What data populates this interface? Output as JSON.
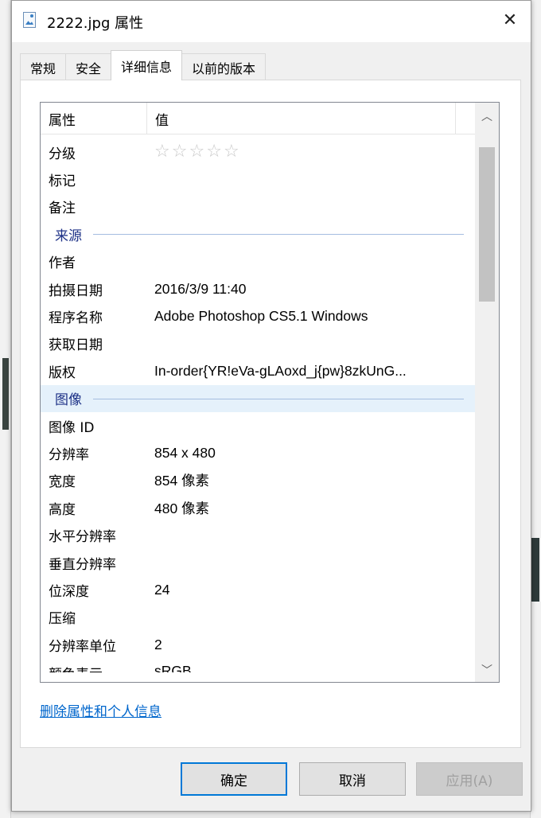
{
  "window": {
    "title": "2222.jpg 属性",
    "icon": "image-file-icon",
    "close_glyph": "✕"
  },
  "tabs": [
    {
      "label": "常规",
      "active": false
    },
    {
      "label": "安全",
      "active": false
    },
    {
      "label": "详细信息",
      "active": true
    },
    {
      "label": "以前的版本",
      "active": false
    }
  ],
  "columns": {
    "property": "属性",
    "value": "值"
  },
  "rating": {
    "stars": 0,
    "max": 5,
    "glyph": "☆"
  },
  "rows": [
    {
      "key": "分级",
      "type": "rating"
    },
    {
      "key": "标记",
      "value": ""
    },
    {
      "key": "备注",
      "value": ""
    },
    {
      "group": "来源"
    },
    {
      "key": "作者",
      "value": ""
    },
    {
      "key": "拍摄日期",
      "value": "2016/3/9 11:40"
    },
    {
      "key": "程序名称",
      "value": "Adobe Photoshop CS5.1 Windows"
    },
    {
      "key": "获取日期",
      "value": ""
    },
    {
      "key": "版权",
      "value": "In-order{YR!eVa-gLAoxd_j{pw}8zkUnG..."
    },
    {
      "group": "图像",
      "selected": true
    },
    {
      "key": "图像 ID",
      "value": ""
    },
    {
      "key": "分辨率",
      "value": "854 x 480"
    },
    {
      "key": "宽度",
      "value": "854 像素"
    },
    {
      "key": "高度",
      "value": "480 像素"
    },
    {
      "key": "水平分辨率",
      "value": ""
    },
    {
      "key": "垂直分辨率",
      "value": ""
    },
    {
      "key": "位深度",
      "value": "24"
    },
    {
      "key": "压缩",
      "value": ""
    },
    {
      "key": "分辨率单位",
      "value": "2"
    },
    {
      "key": "颜色表示",
      "value": "sRGB",
      "partial": true
    }
  ],
  "scrollbar": {
    "up_glyph": "︿",
    "down_glyph": "﹀"
  },
  "remove_link": "删除属性和个人信息",
  "buttons": {
    "ok": "确定",
    "cancel": "取消",
    "apply": "应用(A)"
  },
  "colors": {
    "accent": "#0078d7",
    "group_text": "#1e3287",
    "link": "#0066cc"
  }
}
